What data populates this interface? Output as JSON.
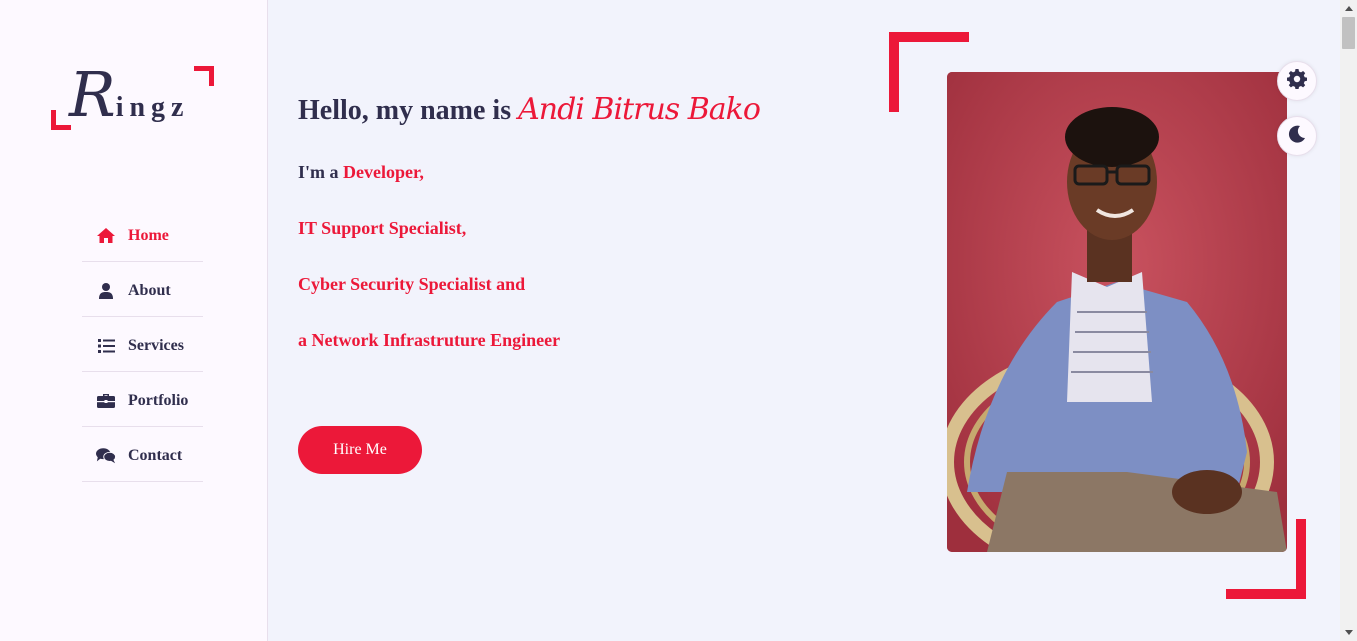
{
  "logo": {
    "initial": "R",
    "rest": "ingz"
  },
  "nav": {
    "items": [
      {
        "label": "Home",
        "icon": "home-icon",
        "active": true
      },
      {
        "label": "About",
        "icon": "user-icon",
        "active": false
      },
      {
        "label": "Services",
        "icon": "list-icon",
        "active": false
      },
      {
        "label": "Portfolio",
        "icon": "briefcase-icon",
        "active": false
      },
      {
        "label": "Contact",
        "icon": "comments-icon",
        "active": false
      }
    ]
  },
  "hero": {
    "greeting_prefix": "Hello, my name is ",
    "name": "Andi Bitrus Bako",
    "role_prefix": "I'm a ",
    "roles": [
      "Developer,",
      "IT Support Specialist,",
      "Cyber Security Specialist and",
      "a Network Infrastruture Engineer"
    ],
    "cta_label": "Hire Me"
  },
  "toolbar": {
    "settings_icon": "gear-icon",
    "theme_icon": "moon-icon"
  },
  "colors": {
    "accent": "#ec1839",
    "text": "#302e4d",
    "background": "#f2f3fc",
    "sidebar": "#fdf9ff"
  }
}
